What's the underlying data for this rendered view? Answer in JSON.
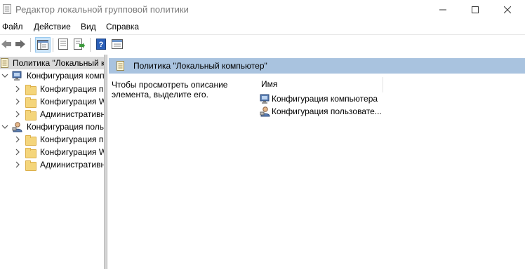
{
  "window": {
    "title": "Редактор локальной групповой политики"
  },
  "menu": [
    "Файл",
    "Действие",
    "Вид",
    "Справка"
  ],
  "tree": {
    "root": "Политика \"Локальный компьютер\"",
    "computer_config": "Конфигурация компьютера",
    "computer_children": [
      "Конфигурация программ",
      "Конфигурация Windows",
      "Административные шаблоны"
    ],
    "user_config": "Конфигурация пользователя",
    "user_children": [
      "Конфигурация программ",
      "Конфигурация Windows",
      "Административные шаблоны"
    ]
  },
  "right_pane": {
    "header": "Политика \"Локальный компьютер\"",
    "description": "Чтобы просмотреть описание элемента, выделите его.",
    "column_name": "Имя",
    "items": [
      "Конфигурация компьютера",
      "Конфигурация пользовате..."
    ]
  },
  "colors": {
    "header_band": "#a9c3df",
    "selected_row": "#d9d9d9",
    "folder": "#f4d57b"
  }
}
